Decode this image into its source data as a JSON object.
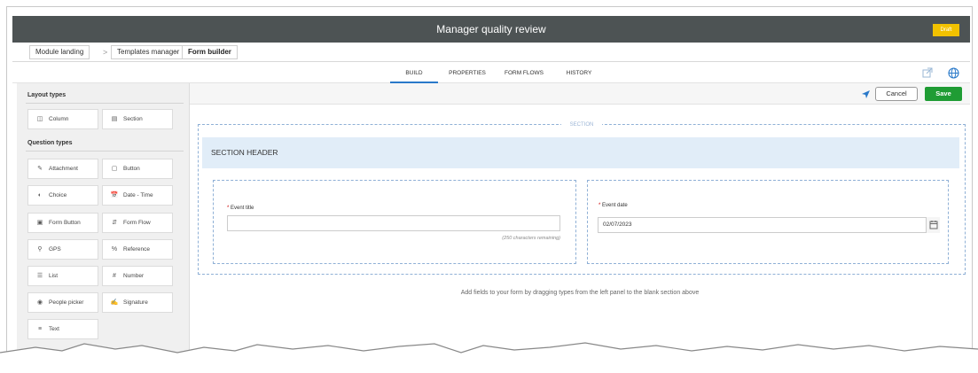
{
  "window": {
    "title": "Manager quality review",
    "status_badge": "Draft"
  },
  "breadcrumb": [
    "Module landing",
    "Templates manager",
    "Form builder"
  ],
  "breadcrumb_separator": ">",
  "tabs": [
    {
      "label": "BUILD",
      "active": true
    },
    {
      "label": "PROPERTIES",
      "active": false
    },
    {
      "label": "FORM FLOWS",
      "active": false
    },
    {
      "label": "HISTORY",
      "active": false
    }
  ],
  "tab_icons": [
    "external-link-icon",
    "globe-icon"
  ],
  "toolbar": {
    "cancel_label": "Cancel",
    "save_label": "Save",
    "send_icon": "send-icon"
  },
  "sidebar": {
    "layout_heading": "Layout types",
    "layout_items": [
      {
        "label": "Column",
        "icon": "column-icon"
      },
      {
        "label": "Section",
        "icon": "section-icon"
      }
    ],
    "question_heading": "Question types",
    "question_items": [
      {
        "label": "Attachment",
        "icon": "paperclip-icon"
      },
      {
        "label": "Button",
        "icon": "button-icon"
      },
      {
        "label": "Choice",
        "icon": "toggle-icon"
      },
      {
        "label": "Date - Time",
        "icon": "calendar-clock-icon"
      },
      {
        "label": "Form Button",
        "icon": "form-button-icon"
      },
      {
        "label": "Form Flow",
        "icon": "form-flow-icon"
      },
      {
        "label": "GPS",
        "icon": "location-pin-icon"
      },
      {
        "label": "Reference",
        "icon": "reference-icon"
      },
      {
        "label": "List",
        "icon": "list-icon"
      },
      {
        "label": "Number",
        "icon": "hash-icon"
      },
      {
        "label": "People picker",
        "icon": "person-icon"
      },
      {
        "label": "Signature",
        "icon": "signature-icon"
      },
      {
        "label": "Text",
        "icon": "text-icon"
      }
    ]
  },
  "canvas": {
    "section_label": "SECTION",
    "section_header": "SECTION HEADER",
    "required_marker": "*",
    "event_title": {
      "label": "Event title",
      "value": "",
      "hint": "(250 characters remaining)"
    },
    "event_date": {
      "label": "Event date",
      "value": "02/07/2023"
    },
    "instructions": "Add fields to your form by dragging types from the left panel to the blank section above"
  },
  "colors": {
    "titlebar": "#4d5354",
    "draft": "#f2c200",
    "save": "#1f9c34",
    "active_tab": "#2979c9",
    "section_header_bg": "#e1edf8"
  }
}
